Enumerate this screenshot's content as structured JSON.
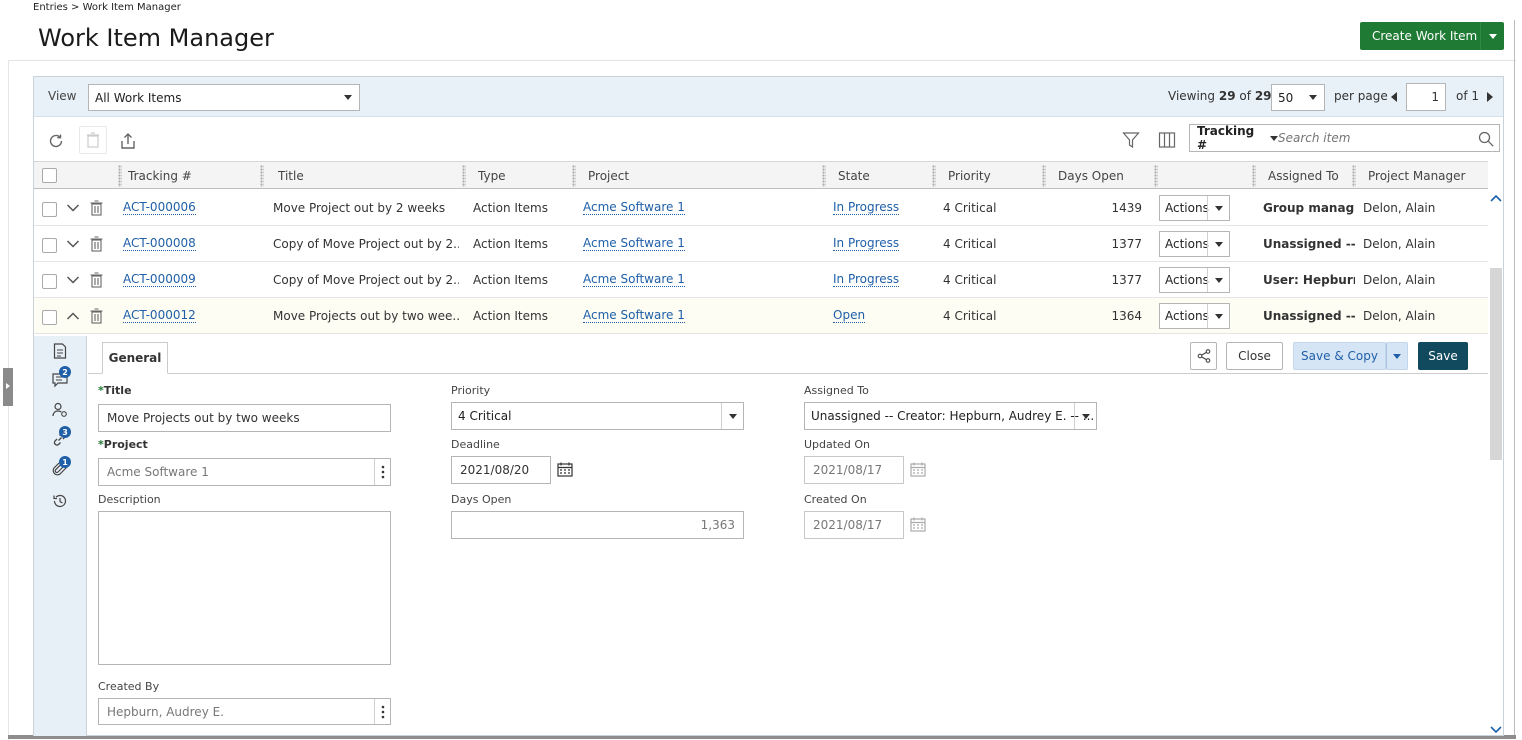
{
  "breadcrumb": "Entries > Work Item Manager",
  "page_title": "Work Item Manager",
  "create_button": "Create Work Item",
  "view_label": "View",
  "view_value": "All Work Items",
  "pager": {
    "viewing_label": "Viewing",
    "shown": "29",
    "of_label": "of",
    "total": "29",
    "per_page_value": "50",
    "per_page_label": "per page",
    "page_value": "1",
    "page_of": "of 1"
  },
  "search": {
    "field": "Tracking #",
    "placeholder": "Search item"
  },
  "columns": {
    "tracking": "Tracking #",
    "title": "Title",
    "type": "Type",
    "project": "Project",
    "state": "State",
    "priority": "Priority",
    "days_open": "Days Open",
    "assigned_to": "Assigned To",
    "project_manager": "Project Manager"
  },
  "rows": [
    {
      "tracking": "ACT-000006",
      "title": "Move Project out by 2 weeks",
      "type": "Action Items",
      "project": "Acme Software 1",
      "state": "In Progress",
      "priority": "4 Critical",
      "days_open": "1439",
      "actions": "Actions",
      "assigned": "Group manag...",
      "pm": "Delon, Alain"
    },
    {
      "tracking": "ACT-000008",
      "title": "Copy of Move Project out by 2...",
      "type": "Action Items",
      "project": "Acme Software 1",
      "state": "In Progress",
      "priority": "4 Critical",
      "days_open": "1377",
      "actions": "Actions",
      "assigned": "Unassigned --...",
      "pm": "Delon, Alain"
    },
    {
      "tracking": "ACT-000009",
      "title": "Copy of Move Project out by 2...",
      "type": "Action Items",
      "project": "Acme Software 1",
      "state": "In Progress",
      "priority": "4 Critical",
      "days_open": "1377",
      "actions": "Actions",
      "assigned": "User: Hepburn...",
      "pm": "Delon, Alain"
    },
    {
      "tracking": "ACT-000012",
      "title": "Move Projects out by two wee...",
      "type": "Action Items",
      "project": "Acme Software 1",
      "state": "Open",
      "priority": "4 Critical",
      "days_open": "1364",
      "actions": "Actions",
      "assigned": "Unassigned --...",
      "pm": "Delon, Alain"
    }
  ],
  "side_badges": {
    "comments": "2",
    "links": "3",
    "attachments": "1"
  },
  "detail": {
    "tab": "General",
    "close": "Close",
    "save_copy": "Save & Copy",
    "save": "Save",
    "title_label": "Title",
    "title_value": "Move Projects out by two weeks",
    "project_label": "Project",
    "project_value": "Acme Software 1",
    "description_label": "Description",
    "created_by_label": "Created By",
    "created_by_value": "Hepburn, Audrey E.",
    "priority_label": "Priority",
    "priority_value": "4 Critical",
    "deadline_label": "Deadline",
    "deadline_value": "2021/08/20",
    "days_open_label": "Days Open",
    "days_open_value": "1,363",
    "assigned_label": "Assigned To",
    "assigned_value": "Unassigned -- Creator: Hepburn, Audrey E. -- ...",
    "updated_label": "Updated On",
    "updated_value": "2021/08/17",
    "created_label": "Created On",
    "created_value": "2021/08/17"
  },
  "colors": {
    "primary_green": "#1f7a34",
    "save_dark": "#114a5e",
    "link_blue": "#1f5fa8",
    "save_copy_bg": "#d6e5f5"
  }
}
